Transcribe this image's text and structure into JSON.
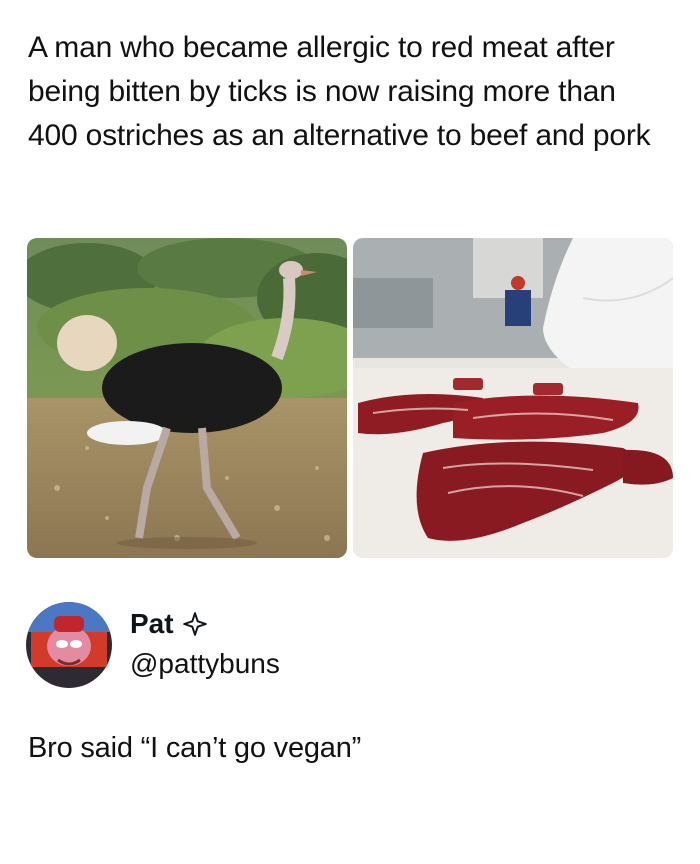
{
  "post": {
    "headline": "A man who became allergic to red meat after being bitten by ticks is now raising more than 400 ostriches as an alternative to beef and pork"
  },
  "media": {
    "left_image": "ostrich-photo",
    "right_image": "raw-steaks-photo"
  },
  "reply": {
    "display_name": "Pat",
    "badge_icon": "sparkle-star-icon",
    "handle": "@pattybuns",
    "text": "Bro said “I can’t go vegan”"
  }
}
